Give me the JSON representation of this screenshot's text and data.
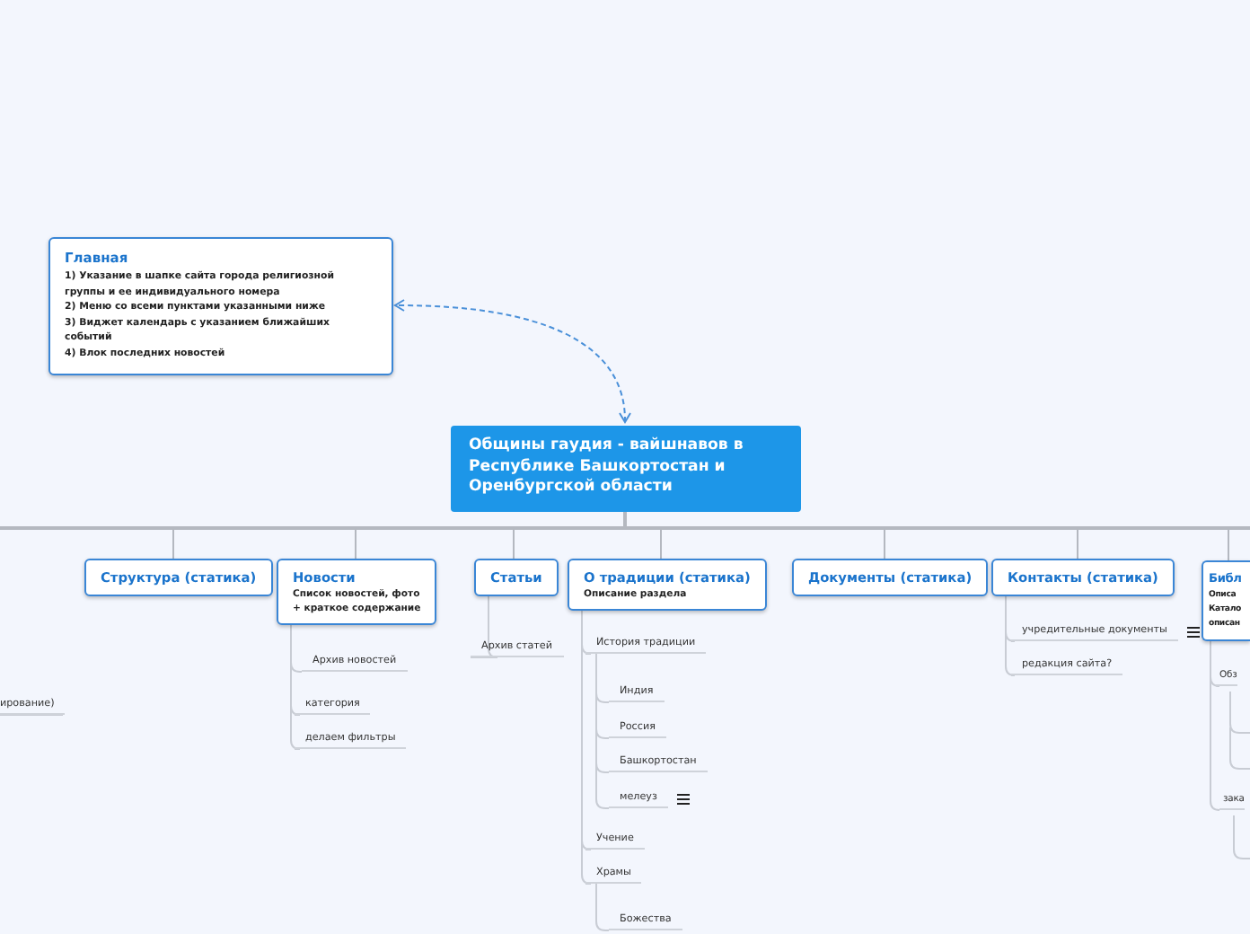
{
  "floating_topic": {
    "title": "Главная",
    "lines": [
      "1) Указание в шапке сайта города религиозной группы и ее индивидуального номера",
      "2) Меню со всеми пунктами указанными ниже",
      "3) Виджет календарь с указанием ближайших событий",
      "4) Влок последних новостей"
    ]
  },
  "main_topic": {
    "title": "Общины гаудия - вайшнавов в Республике Башкортостан и Оренбургской области"
  },
  "offscreen_subtopics": [
    {
      "label": "ирование)",
      "note": false
    }
  ],
  "branches": [
    {
      "title": "Структура (статика)"
    },
    {
      "title": "Новости",
      "description": [
        "Список новостей, фото",
        "+ краткое содержание"
      ],
      "children": [
        {
          "label": "Архив новостей",
          "note": false
        },
        {
          "label": "категория",
          "note": false
        },
        {
          "label": "делаем фильтры",
          "note": false
        }
      ]
    },
    {
      "title": "Статьи",
      "children": [
        {
          "label": "Архив статей",
          "note": false
        }
      ]
    },
    {
      "title": "О традиции (статика)",
      "description": [
        "Описание раздела"
      ],
      "children": [
        {
          "label": "История традиции",
          "note": false,
          "children": [
            {
              "label": "Индия",
              "note": false
            },
            {
              "label": "Россия",
              "note": false
            },
            {
              "label": "Башкортостан",
              "note": false
            },
            {
              "label": "мелеуз",
              "note": true
            }
          ]
        },
        {
          "label": "Учение",
          "note": false
        },
        {
          "label": "Храмы",
          "note": false,
          "children": [
            {
              "label": "Божества",
              "note": false
            }
          ]
        }
      ]
    },
    {
      "title": "Документы (статика)"
    },
    {
      "title": "Контакты (статика)",
      "children": [
        {
          "label": "учредительные документы",
          "note": true
        },
        {
          "label": "редакция сайта?",
          "note": false
        }
      ]
    },
    {
      "title": "Библ",
      "description": [
        "Описа",
        "Катало",
        "описан"
      ],
      "children": [
        {
          "label": "Обз",
          "note": false
        },
        {
          "label": "зака",
          "note": false
        }
      ]
    }
  ]
}
